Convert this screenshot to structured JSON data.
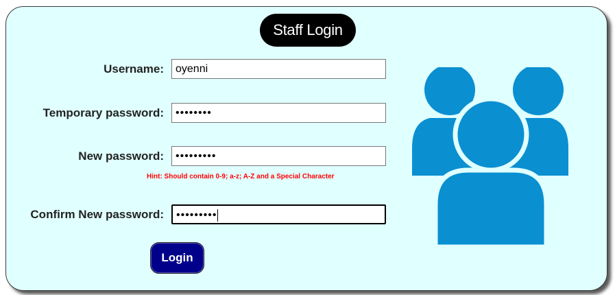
{
  "form": {
    "title": "Staff Login",
    "username_label": "Username:",
    "username_value": "oyenni",
    "temp_password_label": "Temporary password:",
    "temp_password_mask": "••••••••",
    "new_password_label": "New password:",
    "new_password_mask": "•••••••••",
    "hint": "Hint: Should contain 0-9; a-z; A-Z and a Special Character",
    "confirm_password_label": "Confirm New password:",
    "confirm_password_mask": "•••••••••",
    "login_label": "Login"
  },
  "icons": {
    "users": "users-group-icon"
  },
  "colors": {
    "panel_background": "#e0ffff",
    "title_background": "#000000",
    "hint_text": "#ff0000",
    "login_button": "#00008b",
    "icon_blue": "#0a8fd1"
  }
}
